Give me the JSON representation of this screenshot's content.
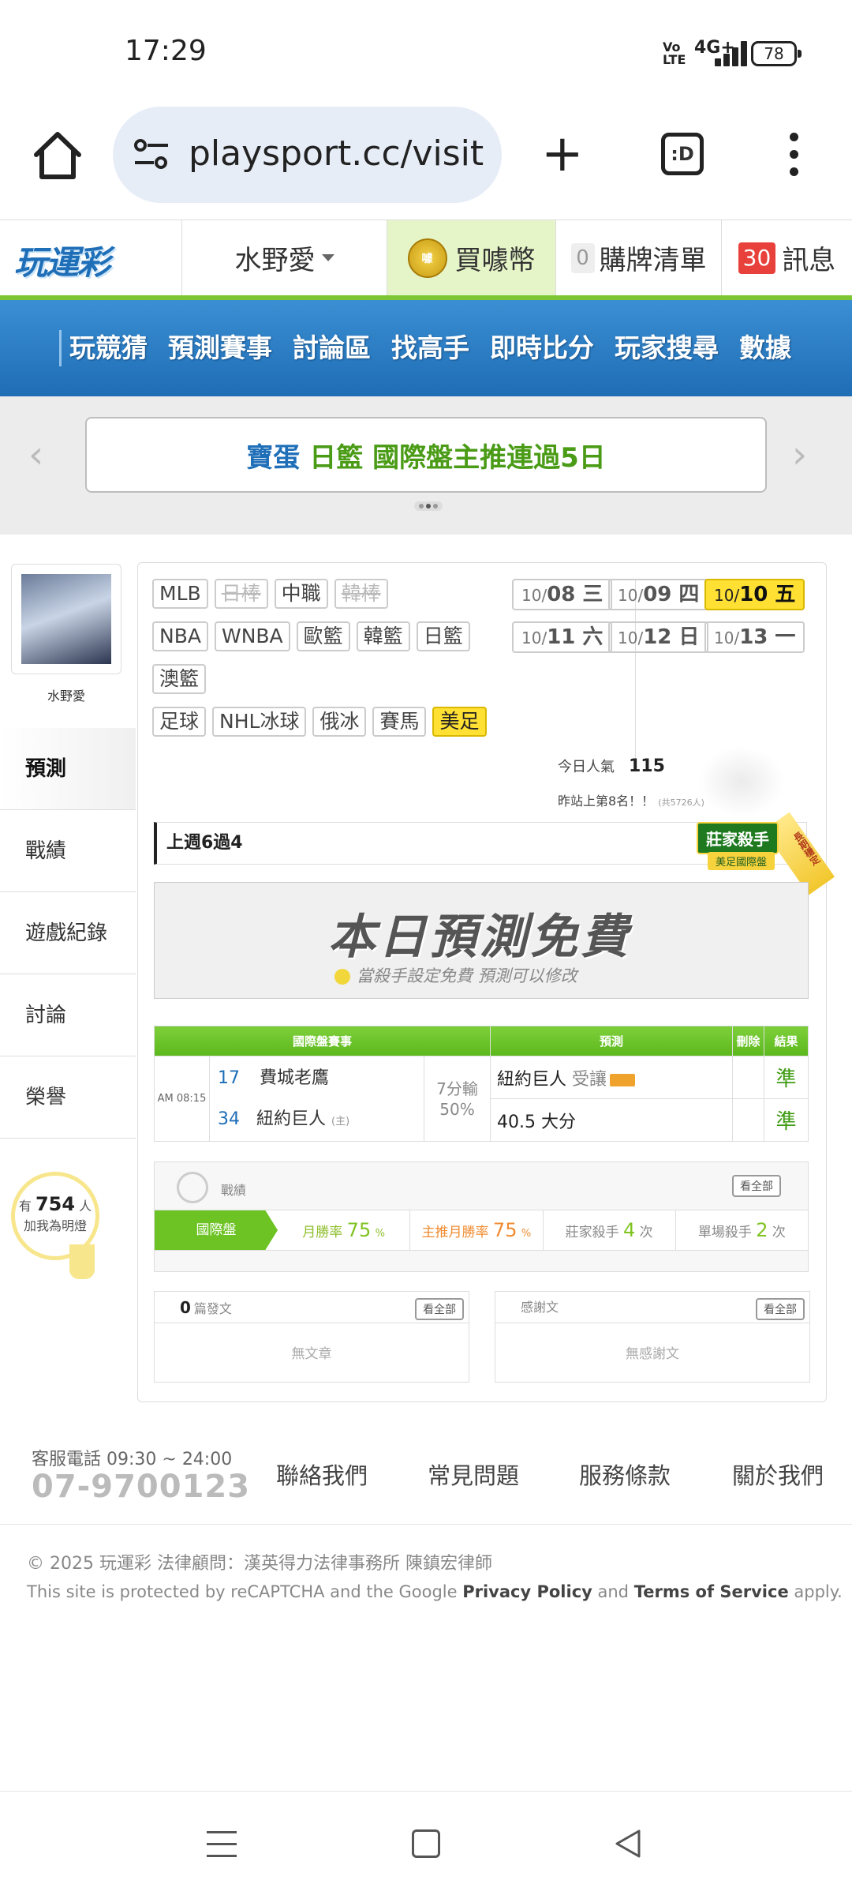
{
  "status_bar": {
    "time": "17:29",
    "volte": "Vo\nLTE",
    "network": "4G+",
    "battery": "78"
  },
  "browser": {
    "url": "playsport.cc/visit",
    "tabs_label": ":D"
  },
  "site_header": {
    "logo": "玩運彩",
    "username": "水野愛",
    "coin_label": "買噱幣",
    "coin_icon_text": "噱",
    "cart_count": "0",
    "cart_label": "購牌清單",
    "msg_count": "30",
    "msg_label": "訊息"
  },
  "nav": {
    "items": [
      "玩競猜",
      "預測賽事",
      "討論區",
      "找高手",
      "即時比分",
      "玩家搜尋",
      "數據"
    ]
  },
  "banner": {
    "part1": "寶蛋",
    "part2": "日籃 國際盤主推連過5日"
  },
  "sidebar": {
    "avatar_name": "水野愛",
    "menu": [
      "預測",
      "戰績",
      "遊戲紀錄",
      "討論",
      "榮譽"
    ],
    "fans_prefix": "有",
    "fans_count": "754",
    "fans_suffix": "人",
    "fans_label": "加我為明燈"
  },
  "leagues": {
    "row1": [
      "MLB",
      "日棒",
      "中職",
      "韓棒"
    ],
    "row2": [
      "NBA",
      "WNBA",
      "歐籃",
      "韓籃",
      "日籃"
    ],
    "row3": [
      "澳籃"
    ],
    "row4": [
      "足球",
      "NHL冰球",
      "俄冰",
      "賽馬",
      "美足"
    ]
  },
  "dates": [
    {
      "md": "10/",
      "d": "08 三"
    },
    {
      "md": "10/",
      "d": "09 四"
    },
    {
      "md": "10/",
      "d": "10 五"
    },
    {
      "md": "10/",
      "d": "11 六"
    },
    {
      "md": "10/",
      "d": "12 日"
    },
    {
      "md": "10/",
      "d": "13 一"
    }
  ],
  "popularity": {
    "label": "今日人氣",
    "value": "115",
    "rank": "昨站上第8名！！",
    "rank_total": "(共5726人)"
  },
  "week_record": "上週6過4",
  "killer_badge": {
    "title": "莊家殺手",
    "sub": "美足國際盤",
    "ribbon": "長期穩定"
  },
  "free_box": {
    "title": "本日預測免費",
    "sub": "當殺手設定免費  預測可以修改"
  },
  "pred_table": {
    "headers": [
      "國際盤賽事",
      "預測",
      "刪除",
      "結果"
    ],
    "time": "AM 08:15",
    "away_num": "17",
    "away_team": "費城老鷹",
    "home_num": "34",
    "home_team": "紐約巨人",
    "home_mark": "(主)",
    "line_top": "7分輸",
    "line_bottom": "50%",
    "pick1": "紐約巨人",
    "pick1_note": "受讓",
    "pick2": "40.5 大分",
    "result1": "準",
    "result2": "準"
  },
  "record": {
    "label": "戰績",
    "see_all": "看全部",
    "tab": "國際盤",
    "month_rate_label": "月勝率",
    "month_rate": "75",
    "pct": "%",
    "main_rate_label": "主推月勝率",
    "main_rate": "75",
    "killer_label": "莊家殺手",
    "killer_count": "4",
    "times": "次",
    "single_label": "單場殺手",
    "single_count": "2"
  },
  "posts": {
    "count": "0",
    "label": "篇發文",
    "see_all": "看全部",
    "empty": "無文章"
  },
  "thanks": {
    "label": "感謝文",
    "see_all": "看全部",
    "empty": "無感謝文"
  },
  "footer": {
    "phone_label": "客服電話 09:30 ~ 24:00",
    "phone": "07-9700123",
    "links": [
      "聯絡我們",
      "常見問題",
      "服務條款",
      "關於我們"
    ],
    "copyright": "© 2025 玩運彩 法律顧問：漢英得力法律事務所 陳鎮宏律師",
    "recaptcha_pre": "This site is protected by reCAPTCHA and the Google ",
    "privacy": "Privacy Policy",
    "and": " and ",
    "terms": "Terms of Service",
    "apply": " apply."
  }
}
